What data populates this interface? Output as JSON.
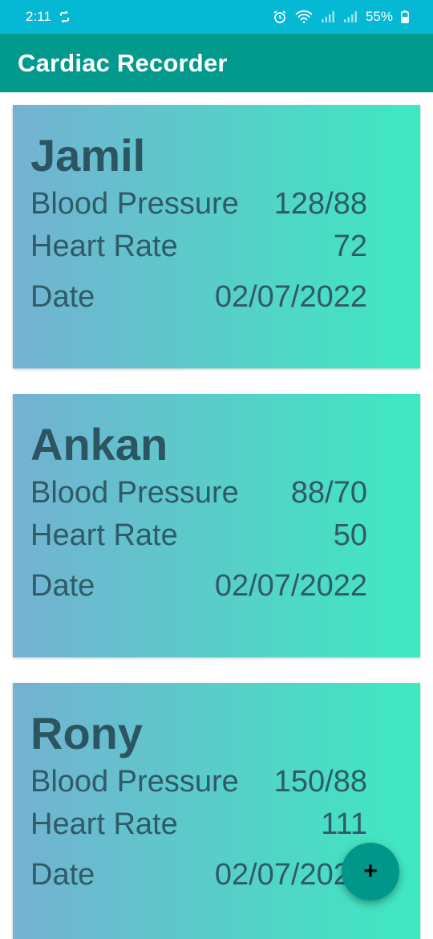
{
  "status_bar": {
    "time": "2:11",
    "battery": "55%",
    "left_icons": [
      "sync-icon"
    ],
    "right_icons": [
      "alarm-icon",
      "wifi-icon",
      "signal-icon",
      "signal-icon",
      "battery-icon"
    ]
  },
  "app_bar": {
    "title": "Cardiac Recorder"
  },
  "records": [
    {
      "name": "Jamil",
      "bp_label": "Blood Pressure",
      "bp_value": "128/88",
      "hr_label": "Heart Rate",
      "hr_value": "72",
      "date_label": "Date",
      "date_value": "02/07/2022"
    },
    {
      "name": "Ankan",
      "bp_label": "Blood Pressure",
      "bp_value": "88/70",
      "hr_label": "Heart Rate",
      "hr_value": "50",
      "date_label": "Date",
      "date_value": "02/07/2022"
    },
    {
      "name": "Rony",
      "bp_label": "Blood Pressure",
      "bp_value": "150/88",
      "hr_label": "Heart Rate",
      "hr_value": "111",
      "date_label": "Date",
      "date_value": "02/07/2022"
    }
  ],
  "fab": {
    "label": "+",
    "icon": "add-icon"
  },
  "colors": {
    "status_bar": "#05b8d4",
    "app_bar": "#019a8c",
    "card_gradient_start": "#74b1d2",
    "card_gradient_end": "#3ee9c1",
    "card_text": "#2f5b68",
    "fab": "#01968a"
  }
}
